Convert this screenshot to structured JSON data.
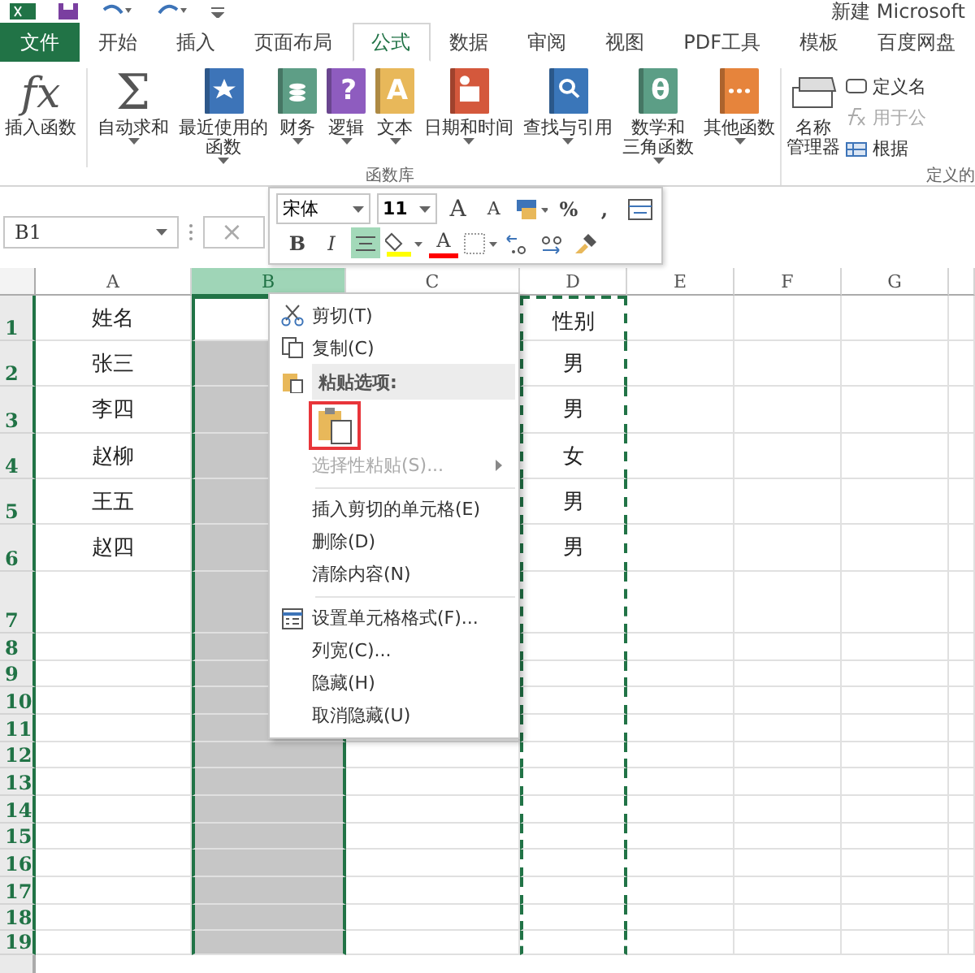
{
  "title_bar": {
    "title": "新建 Microsoft"
  },
  "tabs": [
    {
      "label": "文件",
      "kind": "file",
      "selected": false
    },
    {
      "label": "开始",
      "kind": "tab",
      "selected": false
    },
    {
      "label": "插入",
      "kind": "tab",
      "selected": false
    },
    {
      "label": "页面布局",
      "kind": "tab",
      "selected": false
    },
    {
      "label": "公式",
      "kind": "tab",
      "selected": true
    },
    {
      "label": "数据",
      "kind": "tab",
      "selected": false
    },
    {
      "label": "审阅",
      "kind": "tab",
      "selected": false
    },
    {
      "label": "视图",
      "kind": "tab",
      "selected": false
    },
    {
      "label": "PDF工具",
      "kind": "tab",
      "selected": false
    },
    {
      "label": "模板",
      "kind": "tab",
      "selected": false
    },
    {
      "label": "百度网盘",
      "kind": "tab",
      "selected": false
    }
  ],
  "ribbon": {
    "function_library": {
      "label": "函数库",
      "buttons": [
        {
          "lines": [
            "插入函数"
          ],
          "kind": "fx",
          "glyph": "fx",
          "dropdown": false
        },
        {
          "lines": [
            "自动求和"
          ],
          "kind": "sum",
          "glyph": "Σ",
          "dropdown": true
        },
        {
          "lines": [
            "最近使用的",
            "函数"
          ],
          "kind": "star",
          "dropdown": true
        },
        {
          "lines": [
            "财务"
          ],
          "kind": "coins",
          "dropdown": true
        },
        {
          "lines": [
            "逻辑"
          ],
          "kind": "glyph-purple",
          "glyph": "?",
          "dropdown": true
        },
        {
          "lines": [
            "文本"
          ],
          "kind": "glyph-yellow",
          "glyph": "A",
          "dropdown": true
        },
        {
          "lines": [
            "日期和时间"
          ],
          "kind": "calendar",
          "dropdown": true
        },
        {
          "lines": [
            "查找与引用"
          ],
          "kind": "magnifier",
          "dropdown": true
        },
        {
          "lines": [
            "数学和",
            "三角函数"
          ],
          "kind": "glyph-green",
          "glyph": "θ",
          "dropdown": true
        },
        {
          "lines": [
            "其他函数"
          ],
          "kind": "dots",
          "dropdown": true
        }
      ]
    },
    "defined_names": {
      "label": "定义的",
      "manager": {
        "lines": [
          "名称",
          "管理器"
        ]
      },
      "items": [
        {
          "label": "定义名",
          "kind": "tag",
          "disabled": false
        },
        {
          "label": "用于公",
          "kind": "fx",
          "disabled": true
        },
        {
          "label": "根据",
          "kind": "table",
          "disabled": false
        }
      ]
    }
  },
  "formula_bar": {
    "name_box": "B1",
    "cancel": "×"
  },
  "mini_toolbar": {
    "font": "宋体",
    "size": "11",
    "row_1": [
      {
        "kind": "grow",
        "text": "A"
      },
      {
        "kind": "shrink",
        "text": "A"
      },
      {
        "kind": "format"
      },
      {
        "kind": "text",
        "text": "%"
      },
      {
        "kind": "text",
        "text": ","
      },
      {
        "kind": "wrap"
      }
    ],
    "row_2": [
      {
        "kind": "bold",
        "text": "B",
        "on": false
      },
      {
        "kind": "italic",
        "text": "I",
        "on": false
      },
      {
        "kind": "center",
        "on": true
      },
      {
        "kind": "fill",
        "color": "#ffff00",
        "on": false
      },
      {
        "kind": "font-color",
        "text": "A",
        "color": "#ff0000",
        "on": false
      },
      {
        "kind": "borders",
        "on": false
      },
      {
        "kind": "decimal-more",
        "on": false
      },
      {
        "kind": "decimal-less",
        "on": false
      },
      {
        "kind": "painter",
        "on": false
      }
    ]
  },
  "sheet": {
    "columns": [
      {
        "label": "A",
        "selected": false,
        "copied": false
      },
      {
        "label": "B",
        "selected": true,
        "copied": false
      },
      {
        "label": "C",
        "selected": false,
        "copied": false
      },
      {
        "label": "D",
        "selected": false,
        "copied": true
      },
      {
        "label": "E",
        "selected": false,
        "copied": false
      },
      {
        "label": "F",
        "selected": false,
        "copied": false
      },
      {
        "label": "G",
        "selected": false,
        "copied": false
      }
    ],
    "rows": [
      {
        "label": "1",
        "A": "姓名",
        "D": "性别"
      },
      {
        "label": "2",
        "A": "张三",
        "D": "男"
      },
      {
        "label": "3",
        "A": "李四",
        "D": "男"
      },
      {
        "label": "4",
        "A": "赵柳",
        "D": "女"
      },
      {
        "label": "5",
        "A": "王五",
        "D": "男"
      },
      {
        "label": "6",
        "A": "赵四",
        "D": "男"
      },
      {
        "label": "7"
      },
      {
        "label": "8"
      },
      {
        "label": "9"
      },
      {
        "label": "10"
      },
      {
        "label": "11"
      },
      {
        "label": "12"
      },
      {
        "label": "13"
      },
      {
        "label": "14"
      },
      {
        "label": "15"
      },
      {
        "label": "16"
      },
      {
        "label": "17"
      },
      {
        "label": "18"
      },
      {
        "label": "19"
      }
    ]
  },
  "context_menu": [
    {
      "kind": "cut",
      "label": "剪切(T)",
      "disabled": false,
      "submenu": false
    },
    {
      "kind": "copy",
      "label": "复制(C)",
      "disabled": false,
      "submenu": false
    },
    {
      "kind": "header",
      "label": "粘贴选项:"
    },
    {
      "kind": "paste-options",
      "marked": true
    },
    {
      "kind": "item",
      "label": "选择性粘贴(S)...",
      "disabled": true,
      "submenu": true
    },
    {
      "kind": "separator"
    },
    {
      "kind": "item",
      "label": "插入剪切的单元格(E)",
      "disabled": false,
      "submenu": false
    },
    {
      "kind": "item",
      "label": "删除(D)",
      "disabled": false,
      "submenu": false
    },
    {
      "kind": "item",
      "label": "清除内容(N)",
      "disabled": false,
      "submenu": false
    },
    {
      "kind": "separator"
    },
    {
      "kind": "format",
      "label": "设置单元格格式(F)...",
      "disabled": false,
      "submenu": false
    },
    {
      "kind": "item",
      "label": "列宽(C)...",
      "disabled": false,
      "submenu": false
    },
    {
      "kind": "item",
      "label": "隐藏(H)",
      "disabled": false,
      "submenu": false
    },
    {
      "kind": "item",
      "label": "取消隐藏(U)",
      "disabled": false,
      "submenu": false
    }
  ]
}
